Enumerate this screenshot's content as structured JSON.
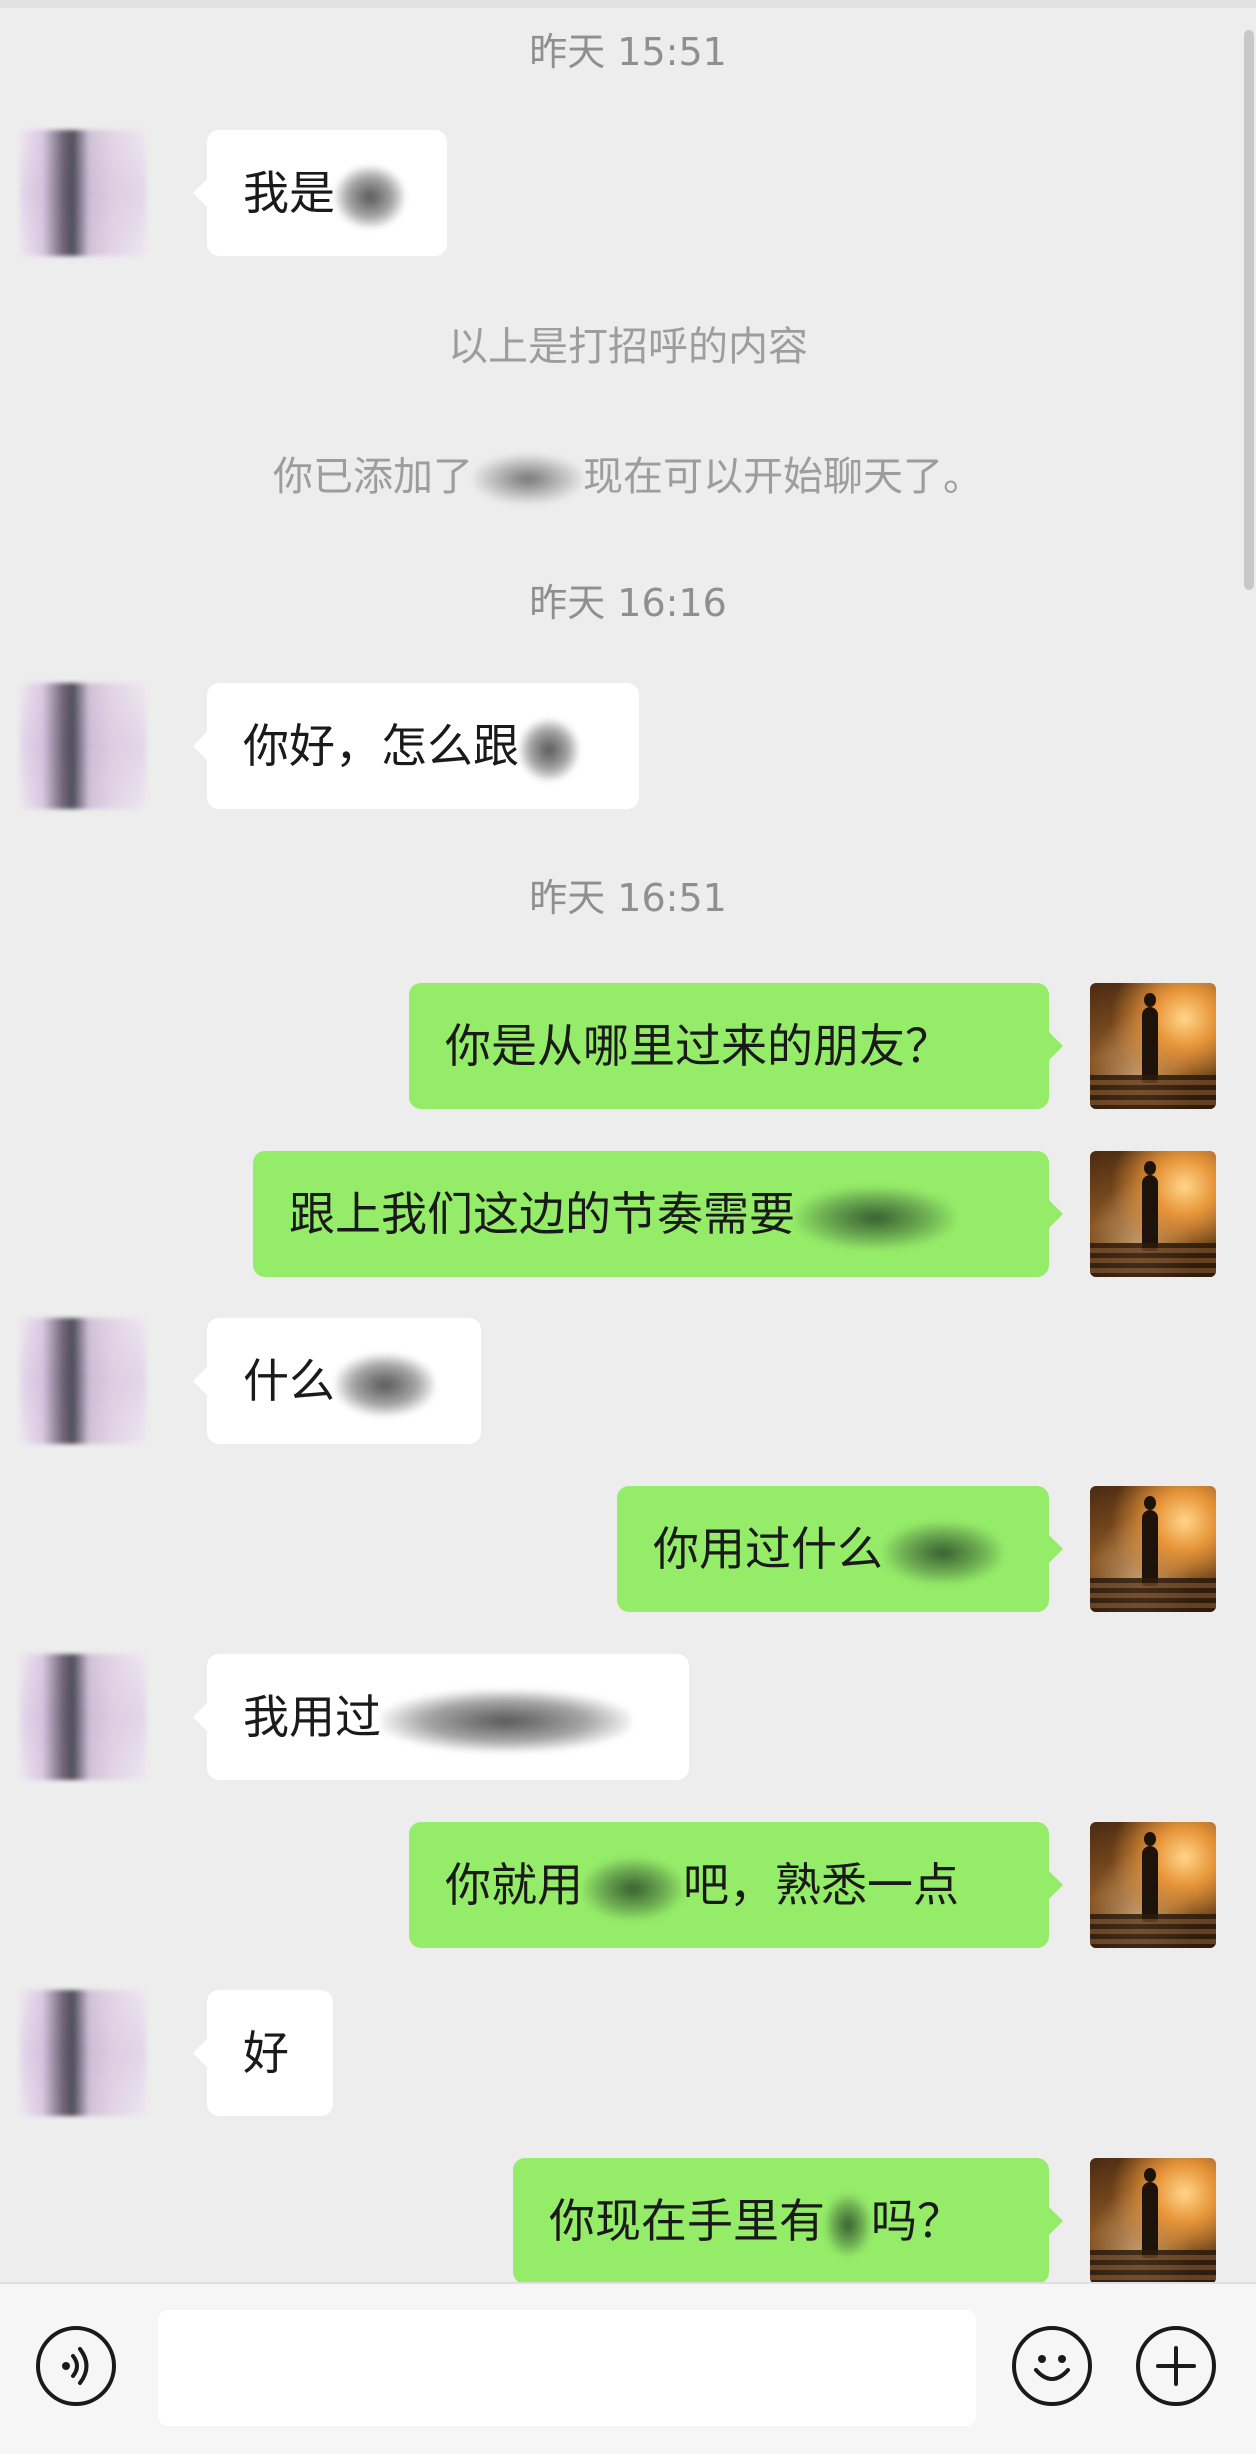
{
  "timestamps": [
    "昨天 15:51",
    "昨天 16:16",
    "昨天 16:51"
  ],
  "system": {
    "greeting_note": "以上是打招呼的内容",
    "added_prefix": "你已添加了",
    "added_suffix": "现在可以开始聊天了。"
  },
  "messages": [
    {
      "side": "in",
      "text": "我是"
    },
    {
      "side": "in",
      "text": "你好，怎么跟"
    },
    {
      "side": "out",
      "text": "你是从哪里过来的朋友？"
    },
    {
      "side": "out",
      "text": "跟上我们这边的节奏需要"
    },
    {
      "side": "in",
      "text": "什么"
    },
    {
      "side": "out",
      "text": "你用过什么"
    },
    {
      "side": "in",
      "text": "我用过"
    },
    {
      "side": "out",
      "text_prefix": "你就用",
      "text_suffix": "吧，熟悉一点"
    },
    {
      "side": "in",
      "text": "好"
    },
    {
      "side": "out",
      "text_prefix": "你现在手里有",
      "text_suffix": "吗？"
    }
  ],
  "input_bar": {
    "voice_icon": "voice-icon",
    "emoji_icon": "emoji-icon",
    "plus_icon": "plus-icon",
    "input_value": ""
  },
  "colors": {
    "background": "#ededed",
    "incoming_bubble": "#ffffff",
    "outgoing_bubble": "#95ec69",
    "timestamp_text": "#8f8f8f",
    "bottom_bar": "#f6f6f6"
  }
}
